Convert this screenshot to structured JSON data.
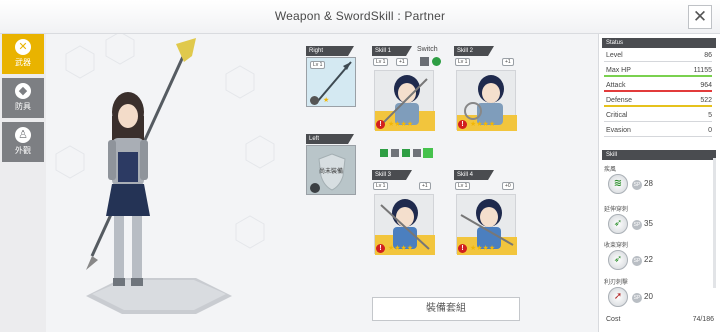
{
  "title": "Weapon & SwordSkill : Partner",
  "tabs": [
    {
      "label": "武器",
      "icon": "swords-icon",
      "active": true
    },
    {
      "label": "防具",
      "icon": "armor-icon",
      "active": false
    },
    {
      "label": "外觀",
      "icon": "appearance-icon",
      "active": false
    }
  ],
  "equip": {
    "right_label": "Right",
    "left_label": "Left",
    "weapon_level": "Lv 1",
    "left_empty_text": "尚未裝備"
  },
  "skills": {
    "switch_label": "Switch",
    "slots": [
      {
        "label": "Skill 1",
        "level": "Lv 1",
        "plus": "+1"
      },
      {
        "label": "Skill 2",
        "level": "Lv 1",
        "plus": "+1"
      },
      {
        "label": "Skill 3",
        "level": "Lv 1",
        "plus": "+1"
      },
      {
        "label": "Skill 4",
        "level": "Lv 1",
        "plus": "+0"
      }
    ]
  },
  "set_button": "裝備套組",
  "status": {
    "header": "Status",
    "rows": [
      {
        "key": "Level",
        "value": "86"
      },
      {
        "key": "Max HP",
        "value": "11155"
      },
      {
        "key": "Attack",
        "value": "964"
      },
      {
        "key": "Defense",
        "value": "522"
      },
      {
        "key": "Critical",
        "value": "5"
      },
      {
        "key": "Evasion",
        "value": "0"
      }
    ],
    "colors": {
      "hp": "#7ad14f",
      "attack": "#e23b3b",
      "defense": "#e6c21c",
      "accent": "#e9b300"
    }
  },
  "skill_panel": {
    "header": "Skill",
    "items": [
      {
        "name": "疾風",
        "sp_label": "SP",
        "sp": "28",
        "icon": "wind-slash-icon",
        "color": "#2d8f2d"
      },
      {
        "name": "延伸穿刺",
        "sp_label": "SP",
        "sp": "35",
        "icon": "pierce-icon",
        "color": "#2d8f2d"
      },
      {
        "name": "收束穿刺",
        "sp_label": "SP",
        "sp": "22",
        "icon": "pierce-icon",
        "color": "#2d8f2d"
      },
      {
        "name": "利刃刺擊",
        "sp_label": "SP",
        "sp": "20",
        "icon": "blade-icon",
        "color": "#b12a2a"
      }
    ]
  },
  "cost": {
    "label": "Cost",
    "value": "74/186"
  }
}
